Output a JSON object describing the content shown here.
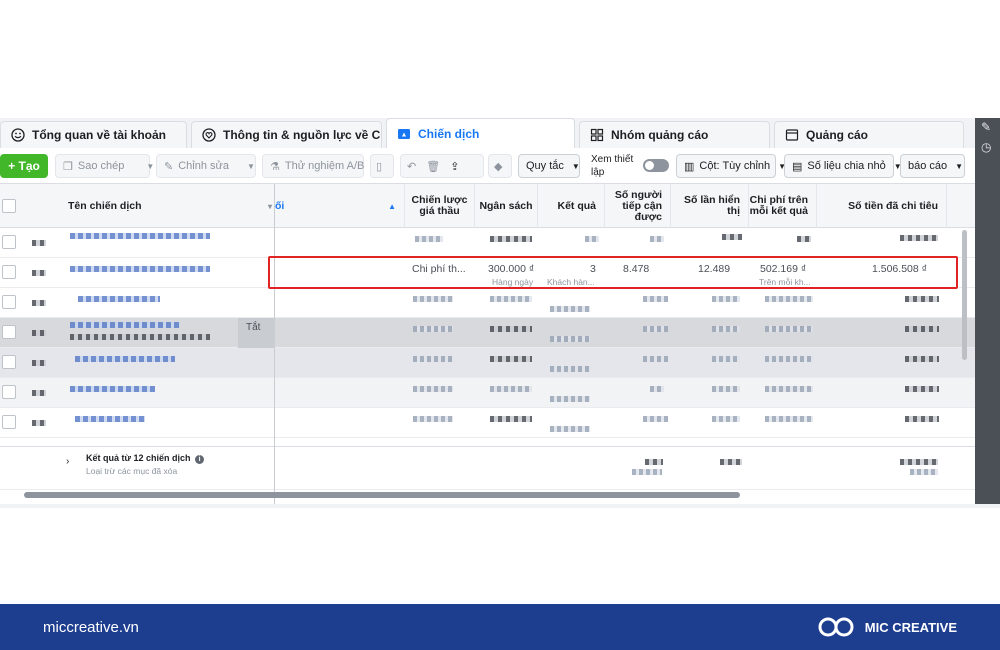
{
  "tabs": [
    {
      "label": "Tổng quan về tài khoản",
      "icon": "smiley-icon"
    },
    {
      "label": "Thông tin & nguồn lực về COV...",
      "icon": "heart-shield-icon"
    },
    {
      "label": "Chiến dịch",
      "icon": "folder-icon"
    },
    {
      "label": "Nhóm quảng cáo",
      "icon": "grid-icon"
    },
    {
      "label": "Quảng cáo",
      "icon": "ad-icon"
    }
  ],
  "toolbar": {
    "create": "+ Tạo",
    "copy": "Sao chép",
    "edit": "Chỉnh sửa",
    "ab_test": "Thử nghiệm A/B",
    "rules": "Quy tắc",
    "view_setup": "Xem thiết lập",
    "columns": "Cột: Tùy chỉnh",
    "breakdown": "Số liệu chia nhỏ",
    "reports": "báo cáo"
  },
  "columns": {
    "name": "Tên chiến dịch",
    "delivery": "ối",
    "bid_strategy": "Chiến lược giá thầu",
    "budget": "Ngân sách",
    "results": "Kết quả",
    "reach": "Số người tiếp cận được",
    "impressions": "Số lần hiển thị",
    "cost_per_result": "Chi phí trên mỗi kết quả",
    "amount_spent": "Số tiền đã chi tiêu"
  },
  "highlighted_row": {
    "bid_strategy": "Chi phí th...",
    "budget": "300.000 ₫",
    "budget_sub": "Hàng ngày",
    "results": "3",
    "results_sub": "Khách hàn...",
    "reach": "8.478",
    "impressions": "12.489",
    "cost_per_result": "502.169 ₫",
    "cost_sub": "Trên mỗi kh...",
    "amount_spent": "1.506.508 ₫"
  },
  "row_label_off": "Tắt",
  "summary": {
    "title": "Kết quả từ 12 chiến dịch",
    "sub": "Loại trừ các mục đã xóa"
  },
  "footer": {
    "site": "miccreative.vn",
    "brand": "MIC CREATIVE"
  },
  "colors": {
    "accent": "#1877f2",
    "create_green": "#42b72a",
    "highlight_red": "#e02424",
    "footer_blue": "#1d3d8f"
  }
}
